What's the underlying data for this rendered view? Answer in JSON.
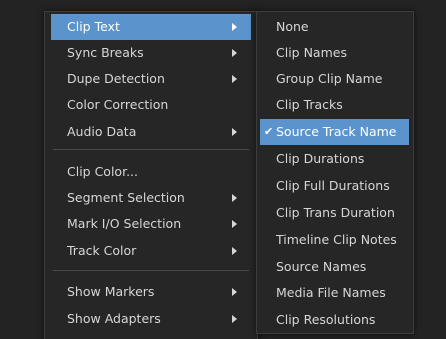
{
  "main_menu": {
    "items": [
      {
        "label": "Clip Text",
        "submenu": true,
        "highlighted": true
      },
      {
        "label": "Sync Breaks",
        "submenu": true
      },
      {
        "label": "Dupe Detection",
        "submenu": true
      },
      {
        "label": "Color Correction",
        "submenu": false
      },
      {
        "label": "Audio Data",
        "submenu": true
      },
      {
        "label": "Clip Color...",
        "submenu": false
      },
      {
        "label": "Segment Selection",
        "submenu": true
      },
      {
        "label": "Mark I/O Selection",
        "submenu": true
      },
      {
        "label": "Track Color",
        "submenu": true
      },
      {
        "label": "Show Markers",
        "submenu": true
      },
      {
        "label": "Show Adapters",
        "submenu": true
      }
    ]
  },
  "clip_text_submenu": {
    "items": [
      {
        "label": "None"
      },
      {
        "label": "Clip Names"
      },
      {
        "label": "Group Clip Name"
      },
      {
        "label": "Clip Tracks"
      },
      {
        "label": "Source Track Name",
        "checked": true,
        "highlighted": true
      },
      {
        "label": "Clip Durations"
      },
      {
        "label": "Clip Full Durations"
      },
      {
        "label": "Clip Trans Duration"
      },
      {
        "label": "Timeline Clip Notes"
      },
      {
        "label": "Source Names"
      },
      {
        "label": "Media File Names"
      },
      {
        "label": "Clip Resolutions"
      }
    ]
  },
  "colors": {
    "highlight": "#5b93cd",
    "menu_background": "#262626",
    "text": "#d6d6d6"
  },
  "icons": {
    "submenu_arrow": "triangle-right-icon",
    "checkmark": "checkmark-icon"
  }
}
